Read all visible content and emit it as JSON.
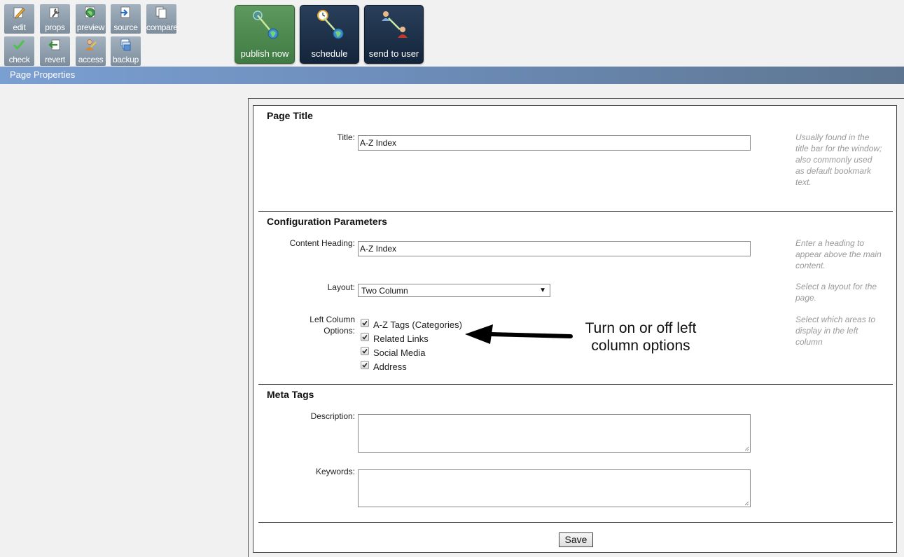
{
  "toolbar": {
    "small_buttons": [
      {
        "label": "edit",
        "icon": "pencil-icon"
      },
      {
        "label": "props",
        "icon": "wrench-icon"
      },
      {
        "label": "preview",
        "icon": "globe-icon"
      },
      {
        "label": "source",
        "icon": "source-arrow-icon"
      },
      {
        "label": "compare",
        "icon": "pages-icon"
      },
      {
        "label": "check",
        "icon": "checkmark-icon"
      },
      {
        "label": "revert",
        "icon": "revert-arrow-icon"
      },
      {
        "label": "access",
        "icon": "user-key-icon"
      },
      {
        "label": "backup",
        "icon": "backup-stack-icon"
      }
    ],
    "big_buttons": [
      {
        "label": "publish now",
        "icon": "publish-signal-icon",
        "color": "#4a8a4e"
      },
      {
        "label": "schedule",
        "icon": "clock-globe-icon",
        "color": "#1b2f48"
      },
      {
        "label": "send to user",
        "icon": "users-transfer-icon",
        "color": "#1b2f48"
      }
    ]
  },
  "page_bar": {
    "title": "Page Properties"
  },
  "form": {
    "page_title_section": {
      "heading": "Page Title",
      "title_label": "Title:",
      "title_value": "A-Z Index",
      "title_help": "Usually found in the title bar for the window; also commonly used as default bookmark text."
    },
    "config_section": {
      "heading": "Configuration Parameters",
      "content_heading_label": "Content Heading:",
      "content_heading_value": "A-Z Index",
      "content_heading_help": "Enter a heading to appear above the main content.",
      "layout_label": "Layout:",
      "layout_value": "Two Column",
      "layout_help": "Select a layout for the page.",
      "left_column_label_line1": "Left Column",
      "left_column_label_line2": "Options:",
      "left_column_help": "Select which areas to display in the left column",
      "left_column_options": [
        {
          "label": "A-Z Tags (Categories)",
          "checked": true
        },
        {
          "label": "Related Links",
          "checked": true
        },
        {
          "label": "Social Media",
          "checked": true
        },
        {
          "label": "Address",
          "checked": true
        }
      ]
    },
    "meta_section": {
      "heading": "Meta Tags",
      "description_label": "Description:",
      "description_value": "",
      "keywords_label": "Keywords:",
      "keywords_value": ""
    },
    "save_label": "Save"
  },
  "annotation": {
    "line1": "Turn on or off left",
    "line2": "column options"
  },
  "colors": {
    "page_bar_start": "#7a9fd1",
    "page_bar_end": "#5d7590",
    "toolbar_button": "#8e9dac",
    "publish_green": "#4a8a4e",
    "dark_navy": "#1b2f48",
    "help_text": "#9a9a9a"
  }
}
